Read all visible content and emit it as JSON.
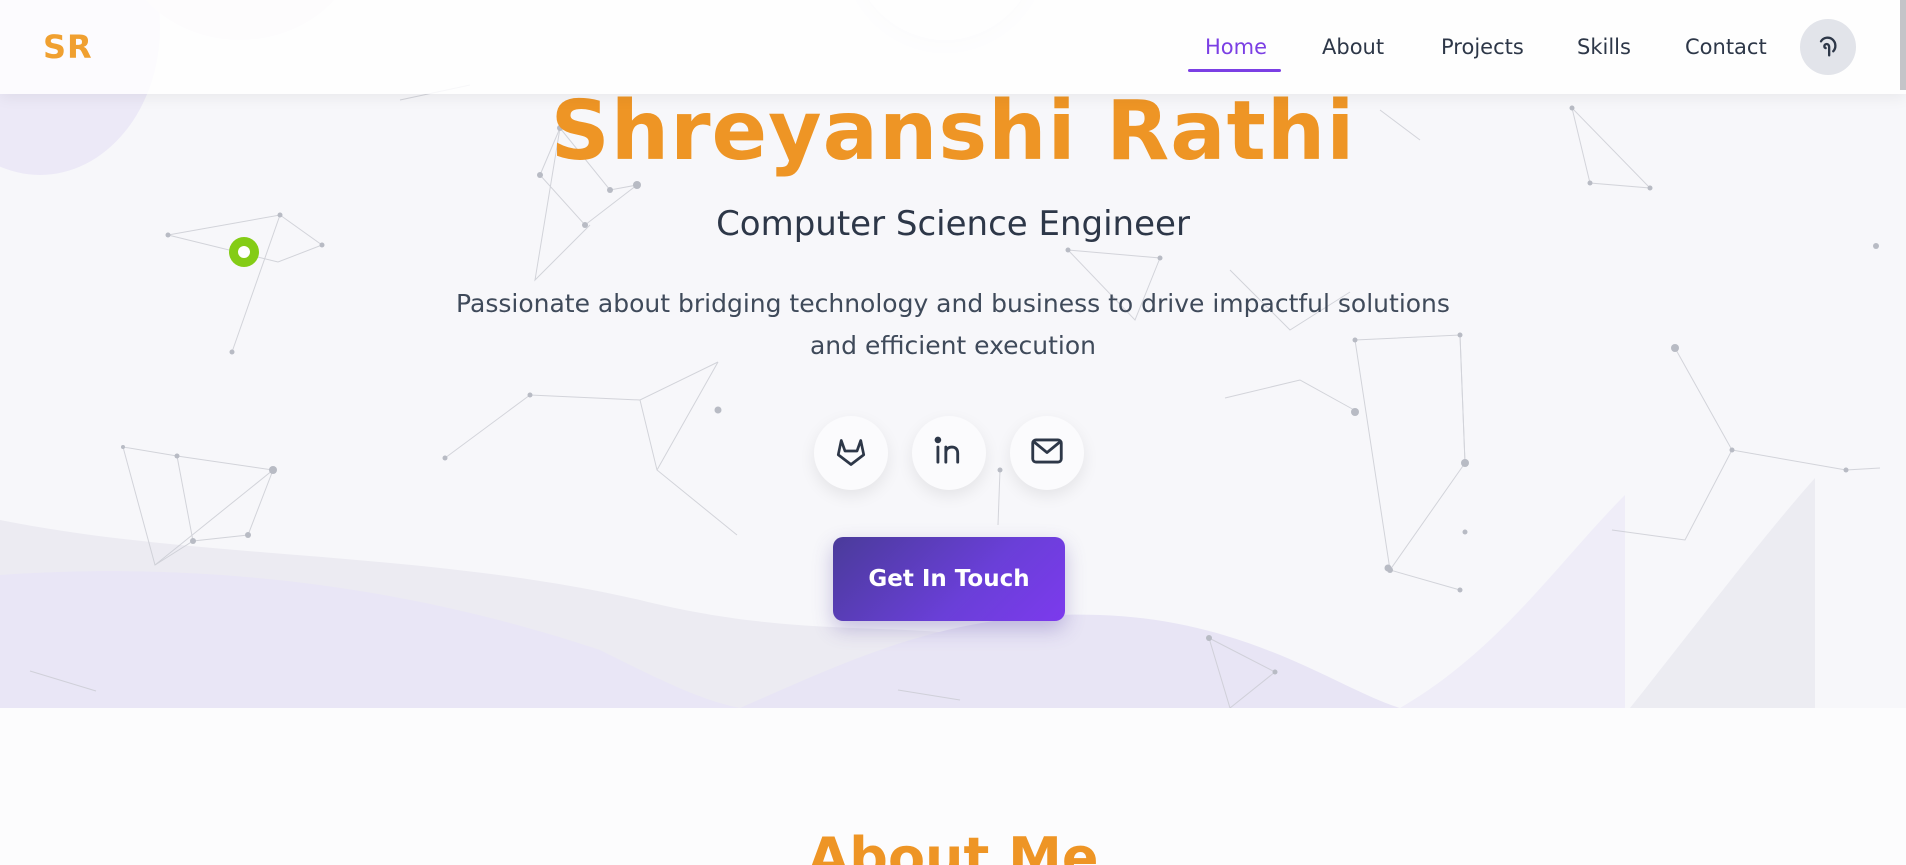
{
  "navbar": {
    "logo": "SR",
    "links": [
      {
        "label": "Home",
        "active": true
      },
      {
        "label": "About",
        "active": false
      },
      {
        "label": "Projects",
        "active": false
      },
      {
        "label": "Skills",
        "active": false
      },
      {
        "label": "Contact",
        "active": false
      }
    ],
    "theme_toggle_icon": "theme-toggle-icon",
    "accent_color": "#7b3fe4"
  },
  "hero": {
    "name": "Shreyanshi Rathi",
    "role": "Computer Science Engineer",
    "description": "Passionate about bridging technology and business to drive impactful solutions and efficient execution",
    "social_icons": [
      "gitlab-icon",
      "linkedin-icon",
      "mail-icon"
    ],
    "cta_label": "Get In Touch",
    "name_color": "#ee9525"
  },
  "about": {
    "title": "About Me"
  }
}
